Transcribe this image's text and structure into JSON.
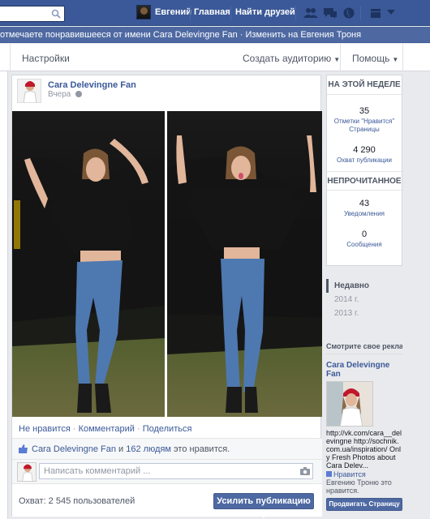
{
  "topbar": {
    "search_placeholder": "",
    "user_name": "Евгений",
    "home": "Главная",
    "find_friends": "Найти друзей"
  },
  "strip": {
    "text": "отмечаете понравившееся от имени Cara Delevingne Fan · Изменить на Евгения Троня"
  },
  "admin_bar": {
    "settings": "Настройки",
    "create_audience": "Создать аудиторию",
    "help": "Помощь"
  },
  "post": {
    "page_name": "Cara Delevingne Fan",
    "time": "Вчера",
    "actions": {
      "unlike": "Не нравится",
      "comment": "Комментарий",
      "share": "Поделиться",
      "sep": "·"
    },
    "likes_prefix": "Cara Delevingne Fan",
    "likes_mid": " и ",
    "likes_count_link": "162 людям",
    "likes_suffix": " это нравится.",
    "comment_placeholder": "Написать комментарий ...",
    "reach_text": "Охват: 2 545 пользователей",
    "boost_label": "Усилить публикацию ▾"
  },
  "stats": {
    "this_week": "НА ЭТОЙ НЕДЕЛЕ",
    "likes_num": "35",
    "likes_lbl": "Отметки \"Нравится\" Страницы",
    "reach_num": "4 290",
    "reach_lbl": "Охват публикации",
    "unread": "НЕПРОЧИТАННОЕ",
    "notif_num": "43",
    "notif_lbl": "Уведомления",
    "msg_num": "0",
    "msg_lbl": "Сообщения"
  },
  "timeline": {
    "years": [
      "Недавно",
      "2014 г.",
      "2013 г."
    ]
  },
  "ads": {
    "head": "Смотрите свое рекла...",
    "title": "Cara Delevingne Fan",
    "text": "http://vk.com/cara__delevingne http://sochnik.com.ua/inspiration/ Only Fresh Photos about Cara Delev...",
    "like": "Нравится",
    "social": "Евгению Троню это нравится.",
    "promote_label": "Продвигать Страницу"
  },
  "colors": {
    "brand": "#3b5998",
    "strip": "#4e69a2",
    "background": "#e9eaed"
  }
}
